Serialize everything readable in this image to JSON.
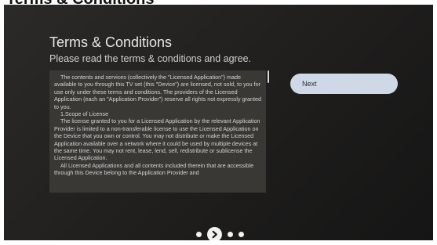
{
  "caption": "Terms & Conditions",
  "dialog": {
    "title": "Terms & Conditions",
    "subtitle": "Please read the terms & conditions and agree.",
    "terms_paragraphs": [
      "The contents and services (collectively the \"Licensed Application\") made available to you through this TV set (this \"Device\") are licensed, not sold, to you for use only under these terms and conditions. The providers of the Licensed Application (each an \"Application Provider\") reserve all rights not expressly granted to you.",
      "1.Scope of License",
      "The license granted to you for a Licensed Application by the relevant Application Provider is limited to a non-transferable license to use the Licensed Application on the Device that you own or control. You may not distribute or make the Licensed Application available over a network where it could be used by multiple devices at the same time. You may not rent, lease, lend, sell, redistribute or sublicense the Licensed Application.",
      "All Licensed Applications and all contents included therein that are accessible through this Device belong to the Application Provider and"
    ],
    "next_label": "Next"
  },
  "pager": {
    "current_step": 2,
    "total_steps": 4,
    "current_icon": "chevron-right-icon"
  }
}
